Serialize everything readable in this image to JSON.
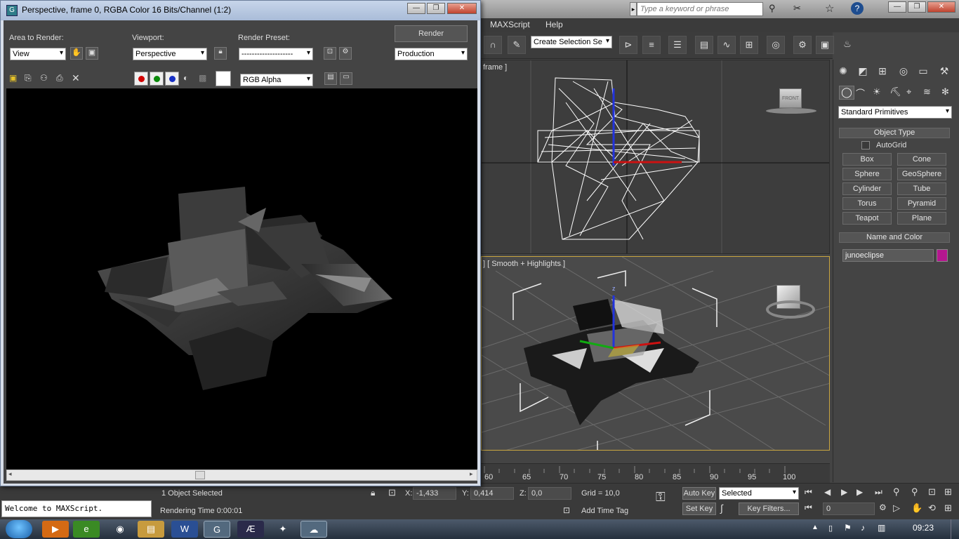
{
  "render_window": {
    "title": "Perspective, frame 0, RGBA Color 16 Bits/Channel (1:2)",
    "area_to_render_label": "Area to Render:",
    "area_to_render_value": "View",
    "viewport_label": "Viewport:",
    "viewport_value": "Perspective",
    "render_preset_label": "Render Preset:",
    "render_preset_value": "--------------------",
    "render_button": "Render",
    "production_value": "Production",
    "channel_value": "RGB Alpha"
  },
  "max": {
    "menu": [
      "MAXScript",
      "Help"
    ],
    "search_placeholder": "Type a keyword or phrase",
    "selection_set": "Create Selection Se",
    "viewport_top_label": "frame ]",
    "viewport_persp_label": "] [ Smooth + Highlights ]",
    "viewcube_front": "FRONT",
    "axis_z": "z",
    "axis_y": "y",
    "axis_x": "x"
  },
  "command_panel": {
    "category": "Standard Primitives",
    "object_type_title": "Object Type",
    "autogrid_label": "AutoGrid",
    "primitives": [
      "Box",
      "Cone",
      "Sphere",
      "GeoSphere",
      "Cylinder",
      "Tube",
      "Torus",
      "Pyramid",
      "Teapot",
      "Plane"
    ],
    "name_color_title": "Name and Color",
    "object_name": "junoeclipse",
    "object_color": "#b5178f"
  },
  "timeline": {
    "ticks": [
      "60",
      "65",
      "70",
      "75",
      "80",
      "85",
      "90",
      "95",
      "100"
    ]
  },
  "status": {
    "listener_text": "Welcome to MAXScript.",
    "selection_info": "1 Object Selected",
    "render_time": "Rendering Time  0:00:01",
    "x_label": "X:",
    "x_value": "-1,433",
    "y_label": "Y:",
    "y_value": "0,414",
    "z_label": "Z:",
    "z_value": "0,0",
    "grid": "Grid = 10,0",
    "add_time_tag": "Add Time Tag",
    "auto_key": "Auto Key",
    "set_key": "Set Key",
    "selected_value": "Selected",
    "key_filters": "Key Filters...",
    "frame_value": "0"
  },
  "taskbar": {
    "clock": "09:23"
  }
}
